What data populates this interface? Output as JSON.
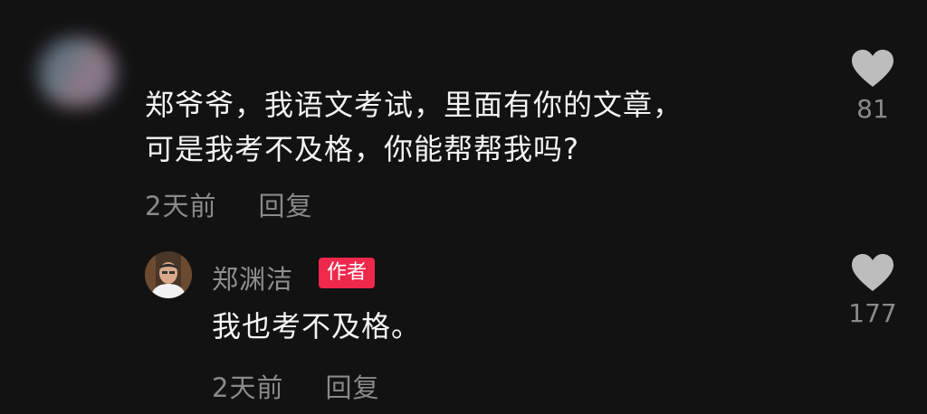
{
  "comment": {
    "avatar": "blurred-avatar",
    "text_line1": "郑爷爷，我语文考试，里面有你的文章，",
    "text_line2": "可是我考不及格，你能帮帮我吗?",
    "time": "2天前",
    "reply_label": "回复",
    "likes": "81"
  },
  "reply": {
    "avatar": "author-photo",
    "author": "郑渊洁",
    "badge": "作者",
    "text": "我也考不及格。",
    "time": "2天前",
    "reply_label": "回复",
    "likes": "177"
  },
  "colors": {
    "background": "#121212",
    "text": "#f4f4f4",
    "meta": "#8a8a8a",
    "badge": "#f0284c",
    "heart": "#bdbdbd"
  },
  "icons": {
    "like": "heart-icon"
  }
}
